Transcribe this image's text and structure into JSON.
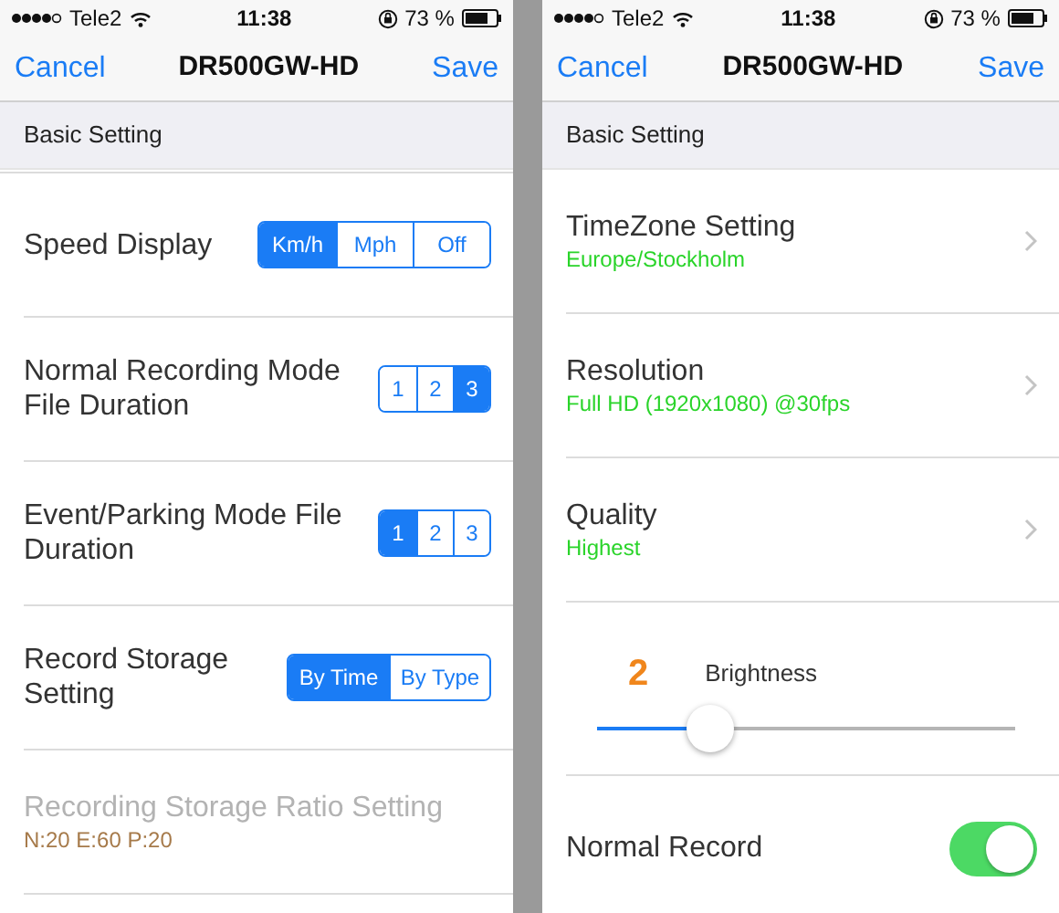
{
  "screens": [
    {
      "status_bar": {
        "carrier": "Tele2",
        "time": "11:38",
        "battery": "73 %"
      },
      "nav": {
        "cancel": "Cancel",
        "title": "DR500GW-HD",
        "save": "Save"
      },
      "section_header": "Basic Setting",
      "rows": [
        {
          "kind": "segmented",
          "label": "Speed Display",
          "options": [
            {
              "label": "Km/h",
              "selected": true
            },
            {
              "label": "Mph",
              "selected": false
            },
            {
              "label": "Off",
              "selected": false
            }
          ]
        },
        {
          "kind": "segmented",
          "label": "Normal Recording Mode File Duration",
          "options": [
            {
              "label": "1",
              "selected": false
            },
            {
              "label": "2",
              "selected": false
            },
            {
              "label": "3",
              "selected": true
            }
          ]
        },
        {
          "kind": "segmented",
          "label": "Event/Parking Mode File Duration",
          "options": [
            {
              "label": "1",
              "selected": true
            },
            {
              "label": "2",
              "selected": false
            },
            {
              "label": "3",
              "selected": false
            }
          ]
        },
        {
          "kind": "segmented",
          "label": "Record Storage Setting",
          "options": [
            {
              "label": "By Time",
              "selected": true
            },
            {
              "label": "By Type",
              "selected": false
            }
          ]
        },
        {
          "kind": "detail",
          "label": "Recording Storage Ratio Setting",
          "value": "N:20 E:60 P:20",
          "disabled": true
        }
      ]
    },
    {
      "status_bar": {
        "carrier": "Tele2",
        "time": "11:38",
        "battery": "73 %"
      },
      "nav": {
        "cancel": "Cancel",
        "title": "DR500GW-HD",
        "save": "Save"
      },
      "section_header": "Basic Setting",
      "rows": [
        {
          "kind": "link",
          "label": "TimeZone Setting",
          "value": "Europe/Stockholm"
        },
        {
          "kind": "link",
          "label": "Resolution",
          "value": "Full HD (1920x1080) @30fps"
        },
        {
          "kind": "link",
          "label": "Quality",
          "value": "Highest"
        },
        {
          "kind": "slider",
          "value": "2",
          "label": "Brightness",
          "level": 0.27
        },
        {
          "kind": "toggle",
          "label": "Normal Record",
          "on": true
        }
      ]
    }
  ]
}
